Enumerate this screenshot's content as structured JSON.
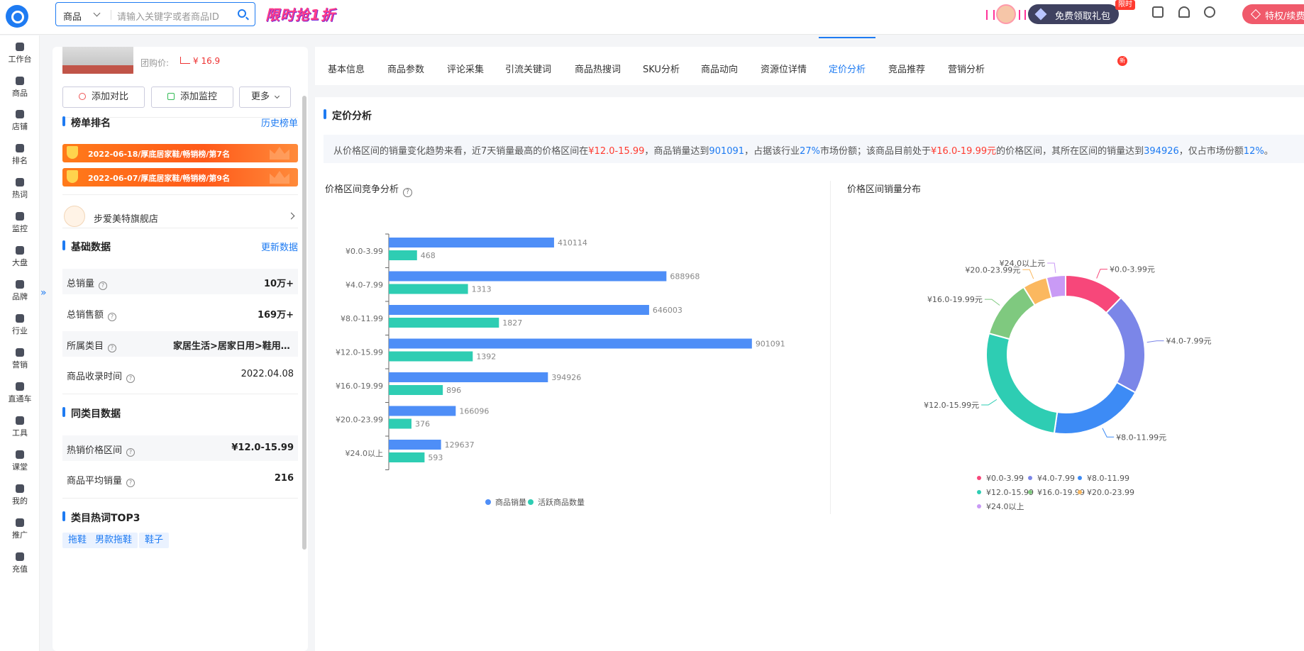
{
  "topbar": {
    "search_type": "商品",
    "search_placeholder": "请输入关键字或者商品ID",
    "promo_banner": "限时抢1折",
    "gift_button": "免费领取礼包",
    "limit_badge": "限时",
    "vip_button": "特权/续费"
  },
  "nav": {
    "items": [
      "工作台",
      "商品",
      "店铺",
      "排名",
      "热词",
      "监控",
      "大盘",
      "品牌",
      "行业",
      "营销",
      "直通车",
      "工具",
      "课堂",
      "我的",
      "推广",
      "充值"
    ]
  },
  "product": {
    "group_price_label": "团购价:",
    "group_price_value": "¥ 16.9",
    "buttons": {
      "compare": "添加对比",
      "monitor": "添加监控",
      "more": "更多"
    }
  },
  "ranking": {
    "title": "榜单排名",
    "link": "历史榜单",
    "items": [
      "2022-06-18/厚底居家鞋/畅销榜/第7名",
      "2022-06-07/厚底居家鞋/畅销榜/第9名"
    ]
  },
  "shop": {
    "name": "步爱美特旗舰店"
  },
  "basic": {
    "title": "基础数据",
    "link": "更新数据",
    "rows": [
      {
        "label": "总销量",
        "value": "10万+"
      },
      {
        "label": "总销售额",
        "value": "169万+"
      },
      {
        "label": "所属类目",
        "value": "家居生活>居家日用>鞋用品>..."
      },
      {
        "label": "商品收录时间",
        "value": "2022.04.08"
      }
    ]
  },
  "same_category": {
    "title": "同类目数据",
    "rows": [
      {
        "label": "热销价格区间",
        "value": "¥12.0-15.99"
      },
      {
        "label": "商品平均销量",
        "value": "216"
      }
    ]
  },
  "hotwords": {
    "title": "类目热词TOP3",
    "items": [
      "拖鞋",
      "男款拖鞋",
      "鞋子"
    ]
  },
  "tabs": {
    "items": [
      "基本信息",
      "商品参数",
      "评论采集",
      "引流关键词",
      "商品热搜词",
      "SKU分析",
      "商品动向",
      "资源位详情",
      "定价分析",
      "竞品推荐",
      "营销分析"
    ],
    "active": "定价分析",
    "new_badge": "新"
  },
  "analysis": {
    "title": "定价分析",
    "summary": {
      "p1": "从价格区间的销量变化趋势来看，近7天销量最高的价格区间在",
      "v1": "¥12.0-15.99",
      "p2": "，商品销量达到",
      "v2": "901091",
      "p3": "，占据该行业",
      "v3": "27%",
      "p4": "市场份额；该商品目前处于",
      "v4": "¥16.0-19.99元",
      "p5": "的价格区间，其所在区间的销量达到",
      "v5": "394926",
      "p6": "，仅占市场份额",
      "v6": "12%",
      "p7": "。"
    },
    "bar_title": "价格区间竞争分析",
    "pie_title": "价格区间销量分布"
  },
  "chart_data": [
    {
      "type": "bar",
      "orientation": "horizontal",
      "title": "价格区间竞争分析",
      "categories": [
        "¥0.0-3.99",
        "¥4.0-7.99",
        "¥8.0-11.99",
        "¥12.0-15.99",
        "¥16.0-19.99",
        "¥20.0-23.99",
        "¥24.0以上"
      ],
      "series": [
        {
          "name": "商品销量",
          "color": "#4e8ef7",
          "values": [
            410114,
            688968,
            646003,
            901091,
            394926,
            166096,
            129637
          ]
        },
        {
          "name": "活跃商品数量",
          "color": "#2ecdb3",
          "values": [
            468,
            1313,
            1827,
            1392,
            896,
            376,
            593
          ]
        }
      ],
      "legend": "bottom",
      "grid": false
    },
    {
      "type": "pie",
      "subtype": "donut",
      "title": "价格区间销量分布",
      "labels": [
        "¥0.0-3.99元",
        "¥4.0-7.99元",
        "¥8.0-11.99元",
        "¥12.0-15.99元",
        "¥16.0-19.99元",
        "¥20.0-23.99元",
        "¥24.0以上元"
      ],
      "legend_labels": [
        "¥0.0-3.99",
        "¥4.0-7.99",
        "¥8.0-11.99",
        "¥12.0-15.99",
        "¥16.0-19.99",
        "¥20.0-23.99",
        "¥24.0以上"
      ],
      "values": [
        410114,
        688968,
        646003,
        901091,
        394926,
        166096,
        129637
      ],
      "colors": [
        "#f7477a",
        "#7b86e8",
        "#3d8bf5",
        "#2ecdb3",
        "#7fc97f",
        "#fbb85f",
        "#c99af5"
      ],
      "legend": "bottom"
    }
  ]
}
